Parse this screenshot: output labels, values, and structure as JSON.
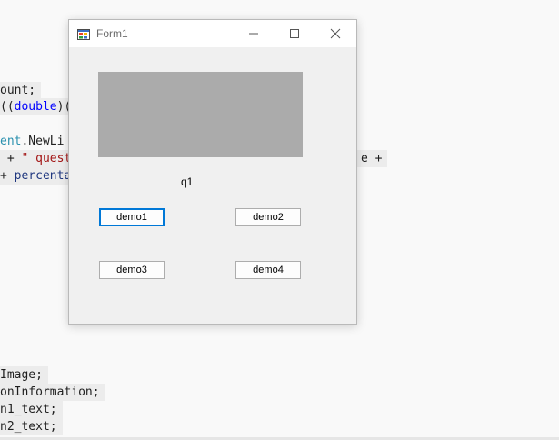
{
  "editor": {
    "lines": [
      {
        "text": "ount;"
      },
      {
        "part1": "((",
        "part2": "double",
        "part3": ")("
      },
      {
        "part1": "ent",
        "part2": ".NewLi"
      },
      {
        "part1": " + ",
        "part2": "\" quest"
      },
      {
        "part1": "+ ",
        "part2": "percenta"
      },
      {
        "text": "Image;"
      },
      {
        "text": "onInformation;"
      },
      {
        "text": "n1_text;"
      },
      {
        "text": "n2_text;"
      }
    ],
    "right_fragment": "e +"
  },
  "window": {
    "title": "Form1",
    "picturebox": {
      "color": "#ababab"
    },
    "label": "q1",
    "buttons": {
      "demo1": "demo1",
      "demo2": "demo2",
      "demo3": "demo3",
      "demo4": "demo4"
    },
    "icons": {
      "app": "form-app-icon",
      "minimize": "minimize-icon",
      "maximize": "maximize-icon",
      "close": "close-icon"
    }
  }
}
